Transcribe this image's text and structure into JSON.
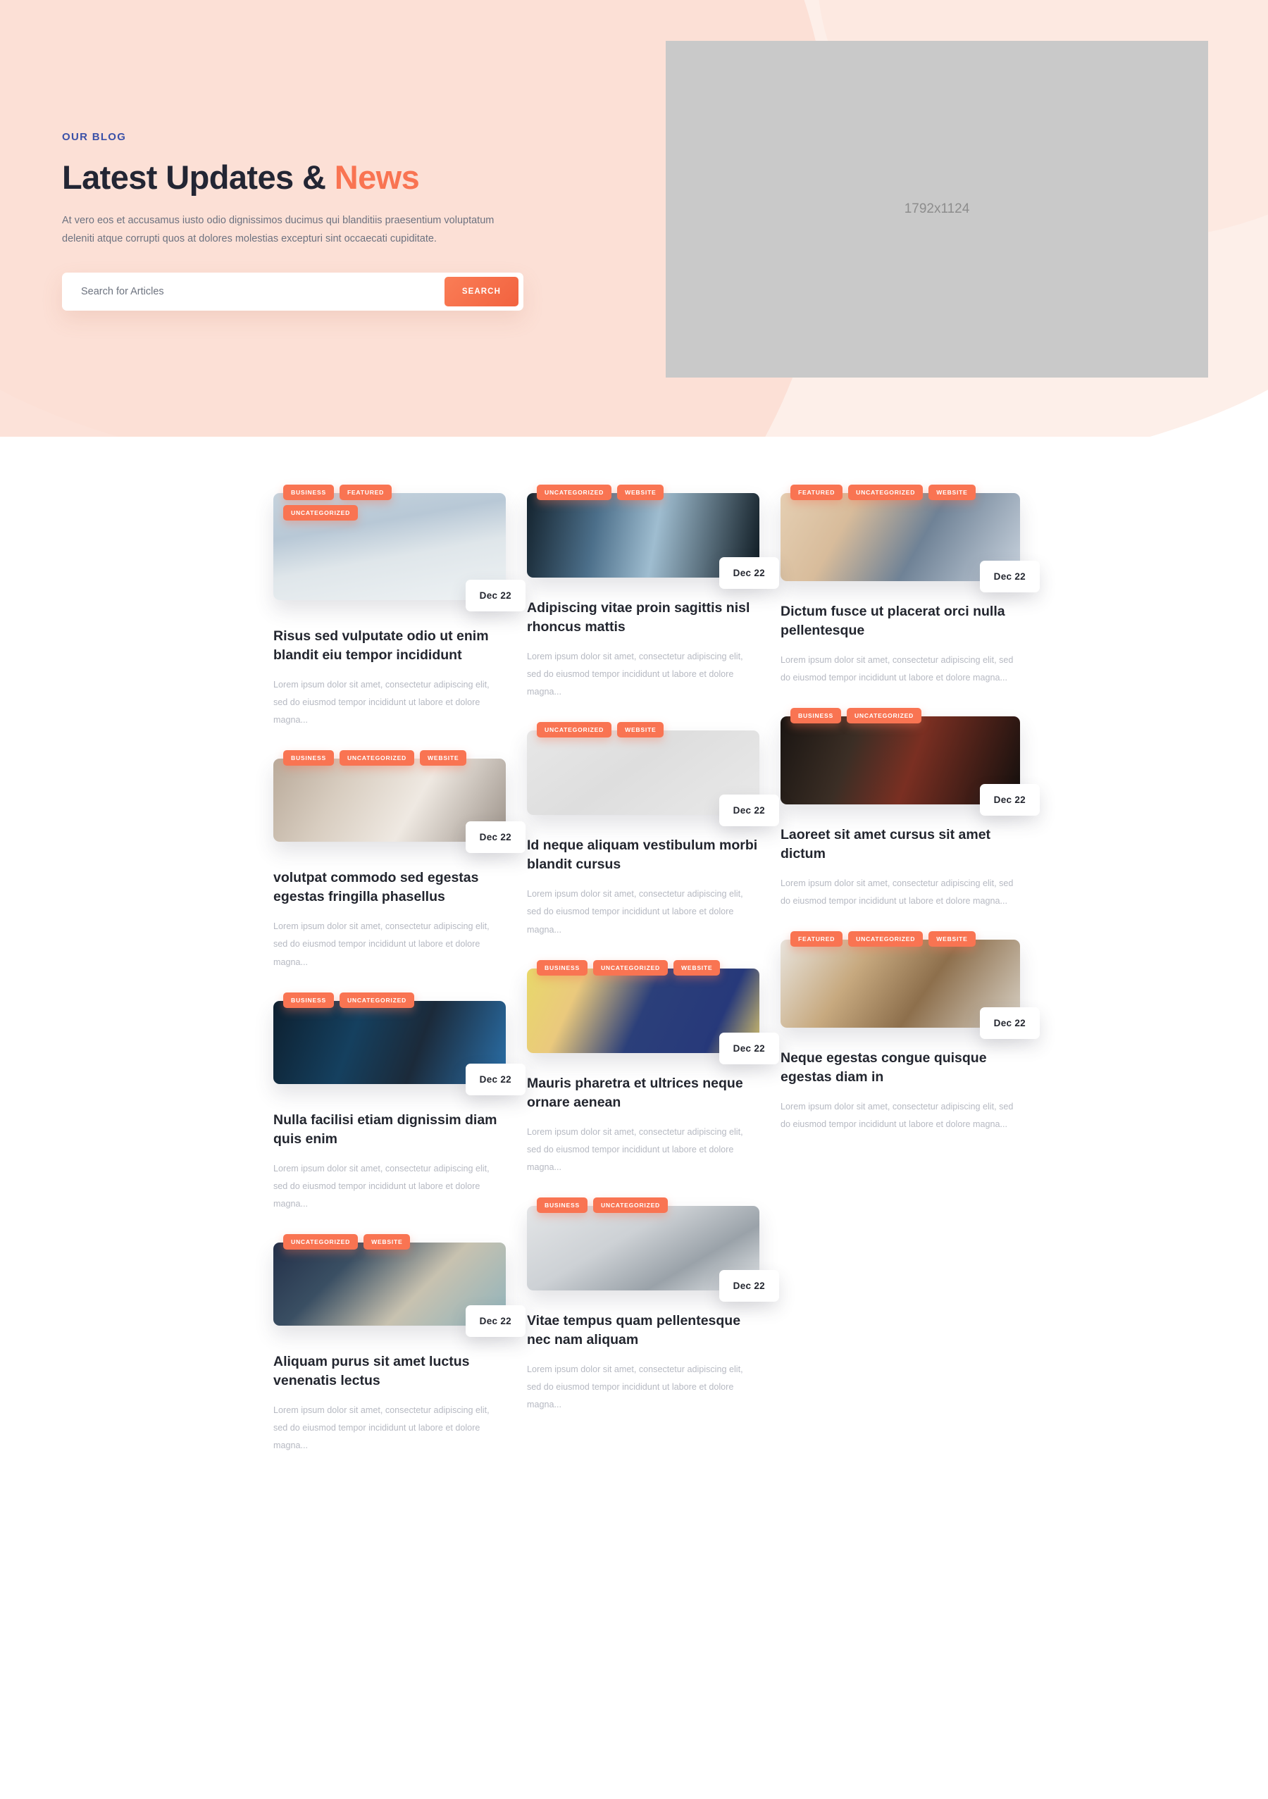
{
  "hero": {
    "eyebrow": "OUR BLOG",
    "title_main": "Latest Updates & ",
    "title_accent": "News",
    "subtitle": "At vero eos et accusamus iusto odio dignissimos ducimus qui blanditiis praesentium voluptatum deleniti atque corrupti quos at dolores molestias excepturi sint occaecati cupiditate.",
    "search_placeholder": "Search for Articles",
    "search_value": "",
    "search_button": "SEARCH",
    "image_placeholder": "1792x1124",
    "accent_color": "#f97452",
    "eyebrow_color": "#3b51a8",
    "background_color": "#fdefe9"
  },
  "excerpt": "Lorem ipsum dolor sit amet, consectetur adipiscing elit, sed do eiusmod tempor incididunt ut labore et dolore magna...",
  "columns": [
    {
      "posts": [
        {
          "tags": [
            "BUSINESS",
            "FEATURED",
            "UNCATEGORIZED"
          ],
          "date": "Dec 22",
          "title": "Risus sed vulputate odio ut enim blandit eiu tempor incididunt",
          "excerpt": "Lorem ipsum dolor sit amet, consectetur adipiscing elit, sed do eiusmod tempor incididunt ut labore et dolore magna...",
          "image": "city-skyline-above-clouds"
        },
        {
          "tags": [
            "BUSINESS",
            "UNCATEGORIZED",
            "WEBSITE"
          ],
          "date": "Dec 22",
          "title": "volutpat commodo sed egestas egestas fringilla phasellus",
          "excerpt": "Lorem ipsum dolor sit amet, consectetur adipiscing elit, sed do eiusmod tempor incididunt ut labore et dolore magna...",
          "image": "laptop-on-wooden-desk"
        },
        {
          "tags": [
            "BUSINESS",
            "UNCATEGORIZED"
          ],
          "date": "Dec 22",
          "title": "Nulla facilisi etiam dignissim diam quis enim",
          "excerpt": "Lorem ipsum dolor sit amet, consectetur adipiscing elit, sed do eiusmod tempor incididunt ut labore et dolore magna...",
          "image": "woman-in-server-room"
        },
        {
          "tags": [
            "UNCATEGORIZED",
            "WEBSITE"
          ],
          "date": "Dec 22",
          "title": "Aliquam purus sit amet luctus venenatis lectus",
          "excerpt": "Lorem ipsum dolor sit amet, consectetur adipiscing elit, sed do eiusmod tempor incididunt ut labore et dolore magna...",
          "image": "woman-with-mug-and-laptop"
        }
      ]
    },
    {
      "posts": [
        {
          "tags": [
            "UNCATEGORIZED",
            "WEBSITE"
          ],
          "date": "Dec 22",
          "title": "Adipiscing vitae proin sagittis nisl rhoncus mattis",
          "excerpt": "Lorem ipsum dolor sit amet, consectetur adipiscing elit, sed do eiusmod tempor incididunt ut labore et dolore magna...",
          "image": "skyscrapers-looking-up"
        },
        {
          "tags": [
            "UNCATEGORIZED",
            "WEBSITE"
          ],
          "date": "Dec 22",
          "title": "Id neque aliquam vestibulum morbi blandit cursus",
          "excerpt": "Lorem ipsum dolor sit amet, consectetur adipiscing elit, sed do eiusmod tempor incididunt ut labore et dolore magna...",
          "image": "flatlay-desk-white"
        },
        {
          "tags": [
            "BUSINESS",
            "UNCATEGORIZED",
            "WEBSITE"
          ],
          "date": "Dec 22",
          "title": "Mauris pharetra et ultrices neque ornare aenean",
          "excerpt": "Lorem ipsum dolor sit amet, consectetur adipiscing elit, sed do eiusmod tempor incididunt ut labore et dolore magna...",
          "image": "phone-social-apps"
        },
        {
          "tags": [
            "BUSINESS",
            "UNCATEGORIZED"
          ],
          "date": "Dec 22",
          "title": "Vitae tempus quam pellentesque nec nam aliquam",
          "excerpt": "Lorem ipsum dolor sit amet, consectetur adipiscing elit, sed do eiusmod tempor incididunt ut labore et dolore magna...",
          "image": "white-desk-laptop"
        }
      ]
    },
    {
      "posts": [
        {
          "tags": [
            "FEATURED",
            "UNCATEGORIZED",
            "WEBSITE"
          ],
          "date": "Dec 22",
          "title": "Dictum fusce ut placerat orci nulla pellentesque",
          "excerpt": "Lorem ipsum dolor sit amet, consectetur adipiscing elit, sed do eiusmod tempor incididunt ut labore et dolore magna...",
          "image": "hands-on-tablet-and-laptop"
        },
        {
          "tags": [
            "BUSINESS",
            "UNCATEGORIZED"
          ],
          "date": "Dec 22",
          "title": "Laoreet sit amet cursus sit amet dictum",
          "excerpt": "Lorem ipsum dolor sit amet, consectetur adipiscing elit, sed do eiusmod tempor incididunt ut labore et dolore magna...",
          "image": "dark-desk-setup"
        },
        {
          "tags": [
            "FEATURED",
            "UNCATEGORIZED",
            "WEBSITE"
          ],
          "date": "Dec 22",
          "title": "Neque egestas congue quisque egestas diam in",
          "excerpt": "Lorem ipsum dolor sit amet, consectetur adipiscing elit, sed do eiusmod tempor incididunt ut labore et dolore magna...",
          "image": "person-working-at-desk"
        }
      ]
    }
  ]
}
